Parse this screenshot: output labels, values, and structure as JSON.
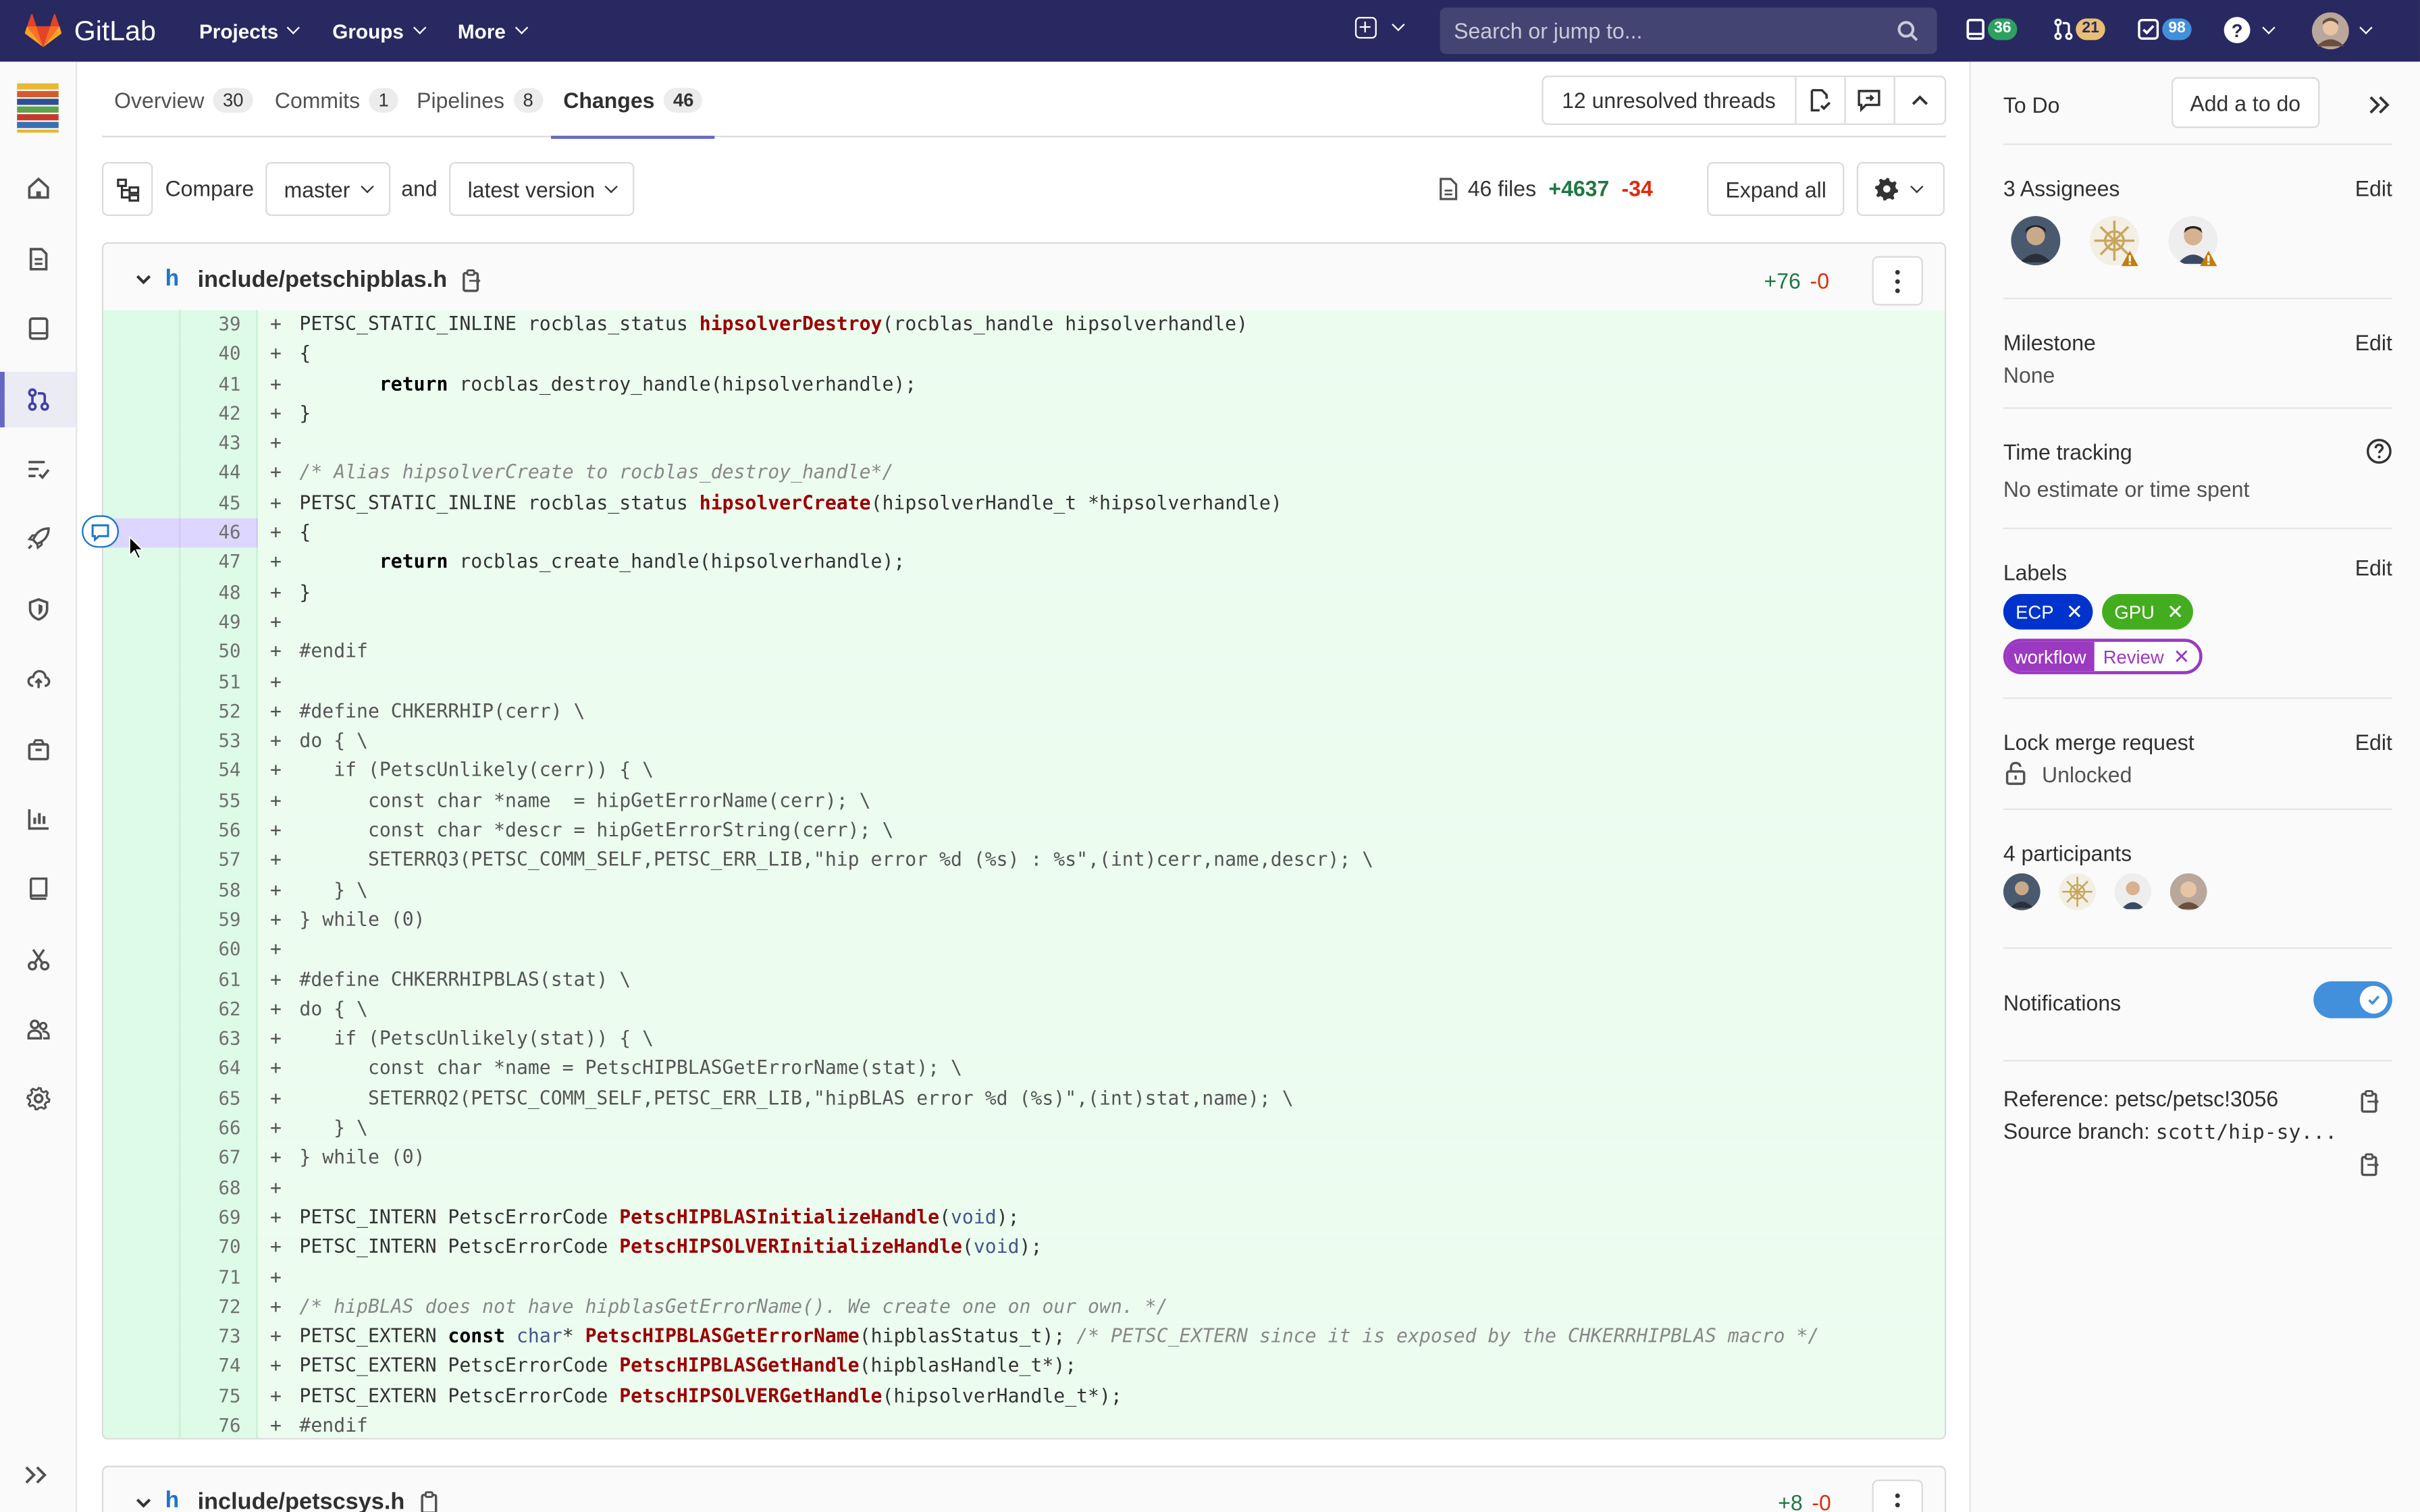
{
  "topbar": {
    "brand": "GitLab",
    "nav": [
      "Projects",
      "Groups",
      "More"
    ],
    "search_placeholder": "Search or jump to...",
    "issues_count": "36",
    "mr_count": "21",
    "todo_count": "98"
  },
  "tabs": [
    {
      "label": "Overview",
      "count": "30"
    },
    {
      "label": "Commits",
      "count": "1"
    },
    {
      "label": "Pipelines",
      "count": "8"
    },
    {
      "label": "Changes",
      "count": "46"
    }
  ],
  "threads": {
    "label": "12 unresolved threads"
  },
  "compare": {
    "compare_label": "Compare",
    "base": "master",
    "and_label": "and",
    "head": "latest version",
    "files": "46 files",
    "additions": "+4637",
    "deletions": "-34",
    "expand_all": "Expand all"
  },
  "file": {
    "type_letter": "h",
    "path": "include/petschipblas.h",
    "additions": "+76",
    "deletions": "-0",
    "lines": [
      {
        "n": "39",
        "t": [
          [
            "p",
            "PETSC_STATIC_INLINE rocblas_status "
          ],
          [
            "fn",
            "hipsolverDestroy"
          ],
          [
            "p",
            "(rocblas_handle hipsolverhandle)"
          ]
        ]
      },
      {
        "n": "40",
        "t": [
          [
            "p",
            "{"
          ]
        ]
      },
      {
        "n": "41",
        "t": [
          [
            "p",
            "       "
          ],
          [
            "kw",
            "return"
          ],
          [
            "p",
            " rocblas_destroy_handle(hipsolverhandle);"
          ]
        ]
      },
      {
        "n": "42",
        "t": [
          [
            "p",
            "}"
          ]
        ]
      },
      {
        "n": "43",
        "t": []
      },
      {
        "n": "44",
        "t": [
          [
            "cm",
            "/* Alias hipsolverCreate to rocblas_destroy_handle*/"
          ]
        ]
      },
      {
        "n": "45",
        "t": [
          [
            "p",
            "PETSC_STATIC_INLINE rocblas_status "
          ],
          [
            "fn",
            "hipsolverCreate"
          ],
          [
            "p",
            "(hipsolverHandle_t *hipsolverhandle)"
          ]
        ]
      },
      {
        "n": "46",
        "t": [
          [
            "p",
            "{"
          ]
        ],
        "hl": true
      },
      {
        "n": "47",
        "t": [
          [
            "p",
            "       "
          ],
          [
            "kw",
            "return"
          ],
          [
            "p",
            " rocblas_create_handle(hipsolverhandle);"
          ]
        ]
      },
      {
        "n": "48",
        "t": [
          [
            "p",
            "}"
          ]
        ]
      },
      {
        "n": "49",
        "t": []
      },
      {
        "n": "50",
        "t": [
          [
            "pp",
            "#endif"
          ]
        ]
      },
      {
        "n": "51",
        "t": []
      },
      {
        "n": "52",
        "t": [
          [
            "pp",
            "#define CHKERRHIP(cerr) \\"
          ]
        ]
      },
      {
        "n": "53",
        "t": [
          [
            "pp",
            "do { \\"
          ]
        ]
      },
      {
        "n": "54",
        "t": [
          [
            "pp",
            "   if (PetscUnlikely(cerr)) { \\"
          ]
        ]
      },
      {
        "n": "55",
        "t": [
          [
            "pp",
            "      const char *name  = hipGetErrorName(cerr); \\"
          ]
        ]
      },
      {
        "n": "56",
        "t": [
          [
            "pp",
            "      const char *descr = hipGetErrorString(cerr); \\"
          ]
        ]
      },
      {
        "n": "57",
        "t": [
          [
            "pp",
            "      SETERRQ3(PETSC_COMM_SELF,PETSC_ERR_LIB,\"hip error %d (%s) : %s\",(int)cerr,name,descr); \\"
          ]
        ]
      },
      {
        "n": "58",
        "t": [
          [
            "pp",
            "   } \\"
          ]
        ]
      },
      {
        "n": "59",
        "t": [
          [
            "pp",
            "} while (0)"
          ]
        ]
      },
      {
        "n": "60",
        "t": []
      },
      {
        "n": "61",
        "t": [
          [
            "pp",
            "#define CHKERRHIPBLAS(stat) \\"
          ]
        ]
      },
      {
        "n": "62",
        "t": [
          [
            "pp",
            "do { \\"
          ]
        ]
      },
      {
        "n": "63",
        "t": [
          [
            "pp",
            "   if (PetscUnlikely(stat)) { \\"
          ]
        ]
      },
      {
        "n": "64",
        "t": [
          [
            "pp",
            "      const char *name = PetscHIPBLASGetErrorName(stat); \\"
          ]
        ]
      },
      {
        "n": "65",
        "t": [
          [
            "pp",
            "      SETERRQ2(PETSC_COMM_SELF,PETSC_ERR_LIB,\"hipBLAS error %d (%s)\",(int)stat,name); \\"
          ]
        ]
      },
      {
        "n": "66",
        "t": [
          [
            "pp",
            "   } \\"
          ]
        ]
      },
      {
        "n": "67",
        "t": [
          [
            "pp",
            "} while (0)"
          ]
        ]
      },
      {
        "n": "68",
        "t": []
      },
      {
        "n": "69",
        "t": [
          [
            "p",
            "PETSC_INTERN PetscErrorCode "
          ],
          [
            "fn",
            "PetscHIPBLASInitializeHandle"
          ],
          [
            "p",
            "("
          ],
          [
            "ty",
            "void"
          ],
          [
            "p",
            ");"
          ]
        ]
      },
      {
        "n": "70",
        "t": [
          [
            "p",
            "PETSC_INTERN PetscErrorCode "
          ],
          [
            "fn",
            "PetscHIPSOLVERInitializeHandle"
          ],
          [
            "p",
            "("
          ],
          [
            "ty",
            "void"
          ],
          [
            "p",
            ");"
          ]
        ]
      },
      {
        "n": "71",
        "t": []
      },
      {
        "n": "72",
        "t": [
          [
            "cm",
            "/* hipBLAS does not have hipblasGetErrorName(). We create one on our own. */"
          ]
        ]
      },
      {
        "n": "73",
        "t": [
          [
            "p",
            "PETSC_EXTERN "
          ],
          [
            "kw",
            "const"
          ],
          [
            "p",
            " "
          ],
          [
            "ty",
            "char"
          ],
          [
            "p",
            "* "
          ],
          [
            "fn",
            "PetscHIPBLASGetErrorName"
          ],
          [
            "p",
            "(hipblasStatus_t); "
          ],
          [
            "cm",
            "/* PETSC_EXTERN since it is exposed by the CHKERRHIPBLAS macro */"
          ]
        ]
      },
      {
        "n": "74",
        "t": [
          [
            "p",
            "PETSC_EXTERN PetscErrorCode "
          ],
          [
            "fn",
            "PetscHIPBLASGetHandle"
          ],
          [
            "p",
            "(hipblasHandle_t*);"
          ]
        ]
      },
      {
        "n": "75",
        "t": [
          [
            "p",
            "PETSC_EXTERN PetscErrorCode "
          ],
          [
            "fn",
            "PetscHIPSOLVERGetHandle"
          ],
          [
            "p",
            "(hipsolverHandle_t*);"
          ]
        ]
      },
      {
        "n": "76",
        "t": [
          [
            "pp",
            "#endif"
          ]
        ]
      }
    ]
  },
  "file2": {
    "type_letter": "h",
    "path": "include/petscsys.h",
    "additions": "+8",
    "deletions": "-0"
  },
  "rsidebar": {
    "todo_label": "To Do",
    "add_todo": "Add a to do",
    "assignees_title": "3 Assignees",
    "edit": "Edit",
    "milestone_title": "Milestone",
    "milestone_value": "None",
    "time_title": "Time tracking",
    "time_value": "No estimate or time spent",
    "labels_title": "Labels",
    "labels": [
      "ECP",
      "GPU"
    ],
    "scoped_label": {
      "key": "workflow",
      "value": "Review"
    },
    "lock_title": "Lock merge request",
    "lock_value": "Unlocked",
    "participants_title": "4 participants",
    "notifications_title": "Notifications",
    "reference": "Reference: petsc/petsc!3056",
    "source_branch_label": "Source branch: ",
    "source_branch": "scott/hip-sy..."
  },
  "colors": {
    "topbar": "#292961",
    "accent": "#6666c4",
    "ecp_label": "#0033cc",
    "gpu_label": "#44ad1f",
    "workflow_label": "#9b39c0",
    "add_line_bg": "#ecfdf0"
  }
}
